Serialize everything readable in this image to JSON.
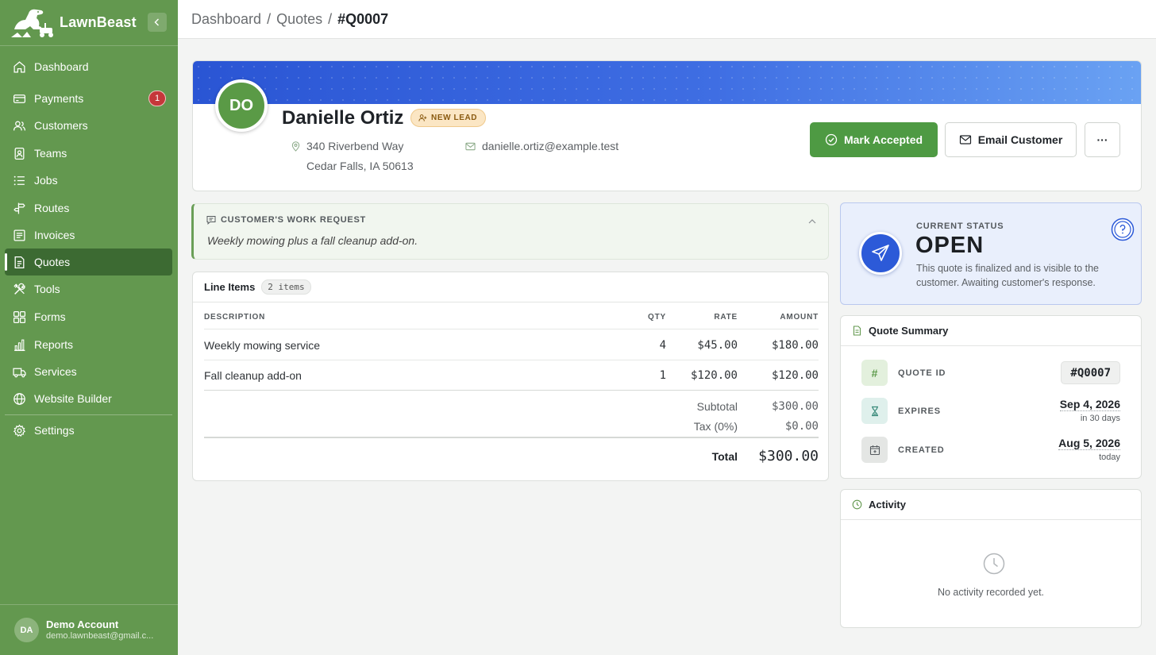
{
  "app": {
    "name": "LawnBeast"
  },
  "sidebar": {
    "items": [
      {
        "label": "Dashboard"
      },
      {
        "label": "Payments",
        "badge": "1"
      },
      {
        "label": "Customers"
      },
      {
        "label": "Teams"
      },
      {
        "label": "Jobs"
      },
      {
        "label": "Routes"
      },
      {
        "label": "Invoices"
      },
      {
        "label": "Quotes",
        "active": true
      },
      {
        "label": "Tools"
      },
      {
        "label": "Forms"
      },
      {
        "label": "Reports"
      },
      {
        "label": "Services"
      },
      {
        "label": "Website Builder"
      },
      {
        "label": "Settings"
      }
    ],
    "account": {
      "initials": "DA",
      "name": "Demo Account",
      "email": "demo.lawnbeast@gmail.c..."
    }
  },
  "breadcrumb": {
    "items": [
      "Dashboard",
      "Quotes"
    ],
    "current": "#Q0007",
    "separator": "/"
  },
  "customer": {
    "initials": "DO",
    "name": "Danielle Ortiz",
    "badge": "NEW LEAD",
    "address_line1": "340 Riverbend Way",
    "address_line2": "Cedar Falls, IA 50613",
    "email": "danielle.ortiz@example.test"
  },
  "actions": {
    "accept": "Mark Accepted",
    "email": "Email Customer",
    "more": "···"
  },
  "work_request": {
    "label": "CUSTOMER'S WORK REQUEST",
    "text": "Weekly mowing plus a fall cleanup add-on."
  },
  "line_items": {
    "title": "Line Items",
    "count": "2 items",
    "headers": {
      "description": "DESCRIPTION",
      "qty": "QTY",
      "rate": "RATE",
      "amount": "AMOUNT"
    },
    "rows": [
      {
        "description": "Weekly mowing service",
        "qty": "4",
        "rate": "$45.00",
        "amount": "$180.00"
      },
      {
        "description": "Fall cleanup add-on",
        "qty": "1",
        "rate": "$120.00",
        "amount": "$120.00"
      }
    ],
    "subtotal_label": "Subtotal",
    "subtotal": "$300.00",
    "tax_label": "Tax (0%)",
    "tax": "$0.00",
    "total_label": "Total",
    "total": "$300.00"
  },
  "status": {
    "label": "CURRENT STATUS",
    "value": "OPEN",
    "description": "This quote is finalized and is visible to the customer. Awaiting customer's response."
  },
  "summary": {
    "title": "Quote Summary",
    "quote_id_label": "QUOTE ID",
    "quote_id": "#Q0007",
    "expires_label": "EXPIRES",
    "expires": "Sep 4, 2026",
    "expires_sub": "in 30 days",
    "created_label": "CREATED",
    "created": "Aug 5, 2026",
    "created_sub": "today"
  },
  "activity": {
    "title": "Activity",
    "empty": "No activity recorded yet."
  },
  "colors": {
    "sidebar": "#63984f",
    "sidebar_active": "#3c6a32",
    "accent_green": "#4e9a43",
    "status_blue": "#2c5ad8",
    "badge_red": "#c5373a"
  }
}
